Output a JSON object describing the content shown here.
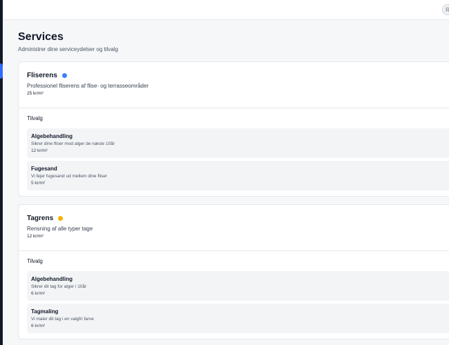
{
  "topbar": {
    "avatar_initial": "R"
  },
  "header": {
    "title": "Services",
    "subtitle": "Administrer dine serviceydelser og tilvalg"
  },
  "colors": {
    "accent": "#2f6bff",
    "dot_blue": "#3b82f6",
    "dot_yellow": "#f5b301"
  },
  "services": [
    {
      "name": "Fliserens",
      "status_color": "#3b82f6",
      "description": "Professionel fliserens af flise- og terrasseområder",
      "price": "25 kr/m²",
      "addons_label": "Tilvalg",
      "addons": [
        {
          "name": "Algebehandling",
          "description": "Sikrer dine fliser mod alger de næste 10år",
          "price": "12 kr/m²"
        },
        {
          "name": "Fugesand",
          "description": "Vi fejer fugesand ud mellem dine fliser",
          "price": "5 kr/m²"
        }
      ]
    },
    {
      "name": "Tagrens",
      "status_color": "#f5b301",
      "description": "Rensning af alle typer tage",
      "price": "12 kr/m²",
      "addons_label": "Tilvalg",
      "addons": [
        {
          "name": "Algebehandling",
          "description": "Sikrer dit tag for alger i 10år",
          "price": "6 kr/m²"
        },
        {
          "name": "Tagmaling",
          "description": "Vi maler dit tag i en valgfri farve",
          "price": "6 kr/m²"
        }
      ]
    }
  ]
}
